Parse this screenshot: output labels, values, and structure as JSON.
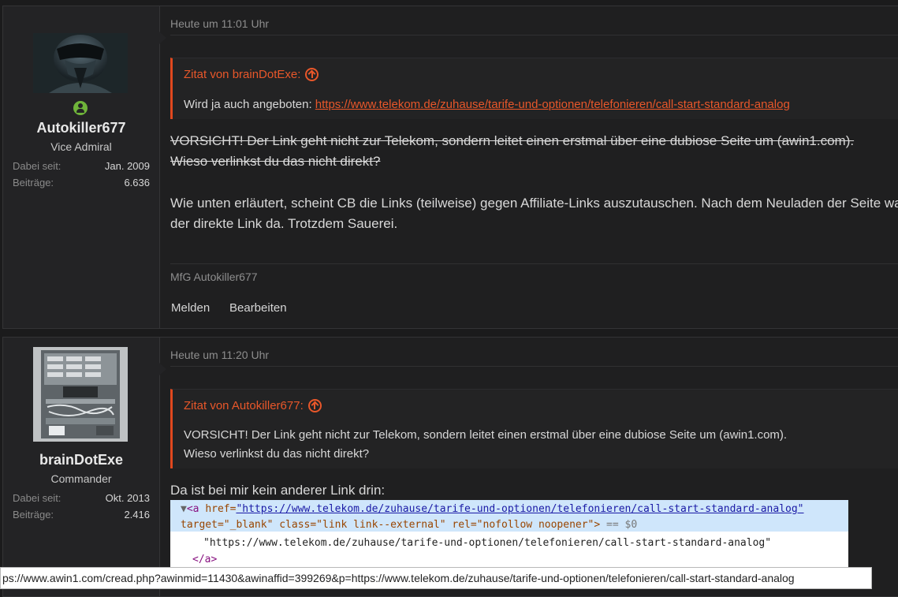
{
  "posts": [
    {
      "user": {
        "name": "Autokiller677",
        "title": "Vice Admiral",
        "joined_label": "Dabei seit:",
        "joined_value": "Jan. 2009",
        "posts_label": "Beiträge:",
        "posts_value": "6.636"
      },
      "date": "Heute um 11:01 Uhr",
      "quote": {
        "author": "Zitat von brainDotExe:",
        "prefix": "Wird ja auch angeboten: ",
        "link": "https://www.telekom.de/zuhause/tarife-und-optionen/telefonieren/call-start-standard-analog"
      },
      "strike_line1": "VORSICHT! Der Link geht nicht zur Telekom, sondern leitet einen erstmal über eine dubiose Seite um (awin1.com).",
      "strike_line2": "Wieso verlinkst du das nicht direkt?",
      "body_line1": "Wie unten erläutert, scheint CB die Links (teilweise) gegen Affiliate-Links auszutauschen. Nach dem Neuladen der Seite war",
      "body_line2": "der direkte Link da. Trotzdem Sauerei.",
      "signature": "MfG Autokiller677",
      "actions": {
        "report": "Melden",
        "edit": "Bearbeiten"
      }
    },
    {
      "user": {
        "name": "brainDotExe",
        "title": "Commander",
        "joined_label": "Dabei seit:",
        "joined_value": "Okt. 2013",
        "posts_label": "Beiträge:",
        "posts_value": "2.416"
      },
      "date": "Heute um 11:20 Uhr",
      "quote": {
        "author": "Zitat von Autokiller677:",
        "line1": "VORSICHT! Der Link geht nicht zur Telekom, sondern leitet einen erstmal über eine dubiose Seite um (awin1.com).",
        "line2": "Wieso verlinkst du das nicht direkt?"
      },
      "body_line1": "Da ist bei mir kein anderer Link drin:",
      "devtools": {
        "line1_open": "<a ",
        "line1_attr_href": "href=",
        "line1_href_val": "\"https://www.telekom.de/zuhause/tarife-und-optionen/telefonieren/call-start-standard-analog\"",
        "line2_attrs": "target=\"_blank\" class=\"link link--external\" rel=\"nofollow noopener\">",
        "line2_eq": " == $0",
        "line3": "\"https://www.telekom.de/zuhause/tarife-und-optionen/telefonieren/call-start-standard-analog\"",
        "line4": "</a>"
      }
    }
  ],
  "status_bar": "ps://www.awin1.com/cread.php?awinmid=11430&awinaffid=399269&p=https://www.telekom.de/zuhause/tarife-und-optionen/telefonieren/call-start-standard-analog",
  "colors": {
    "accent": "#e8572a",
    "online": "#6fb43a",
    "background": "#1b1b1c"
  }
}
